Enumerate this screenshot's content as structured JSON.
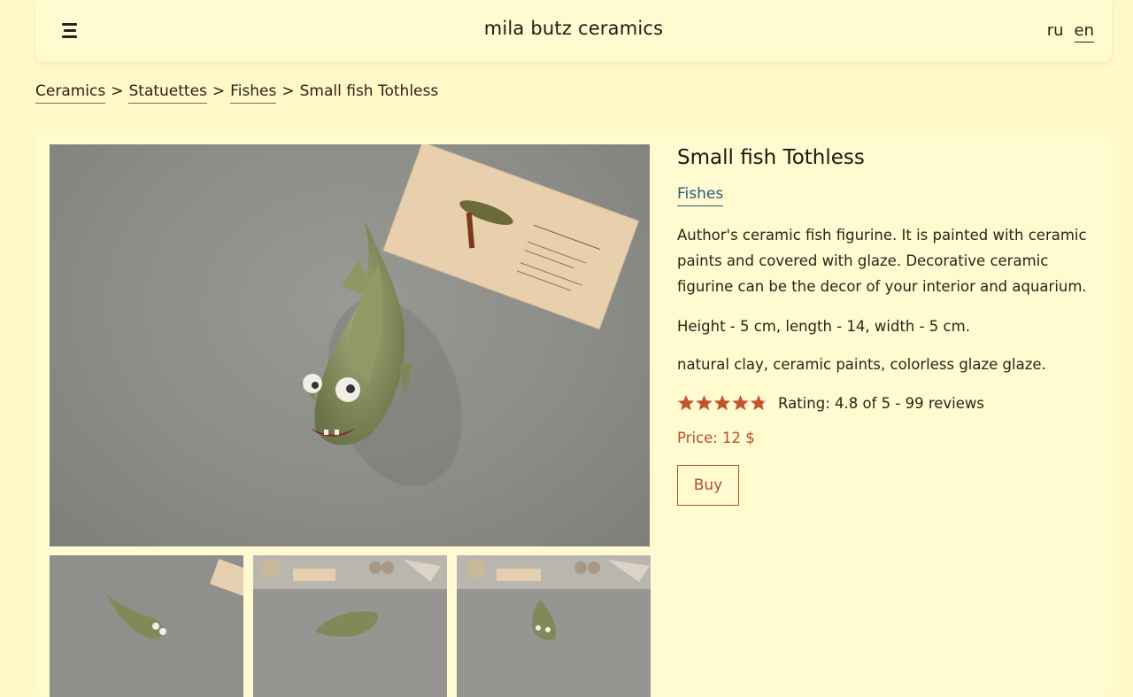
{
  "header": {
    "site_title": "mila butz ceramics",
    "menu_icon": "hamburger-icon",
    "languages": [
      {
        "label": "ru",
        "active": false
      },
      {
        "label": "en",
        "active": true
      }
    ]
  },
  "breadcrumb": {
    "items": [
      "Ceramics",
      "Statuettes",
      "Fishes"
    ],
    "current": "Small fish Tothless",
    "separator": ">"
  },
  "product": {
    "title": "Small fish Tothless",
    "category": "Fishes",
    "description": "Author's ceramic fish figurine. It is painted with ceramic paints and covered with glaze. Decorative ceramic figurine can be the decor of your interior and aquarium.",
    "dimensions": "Height - 5 cm, length - 14, width - 5 cm.",
    "materials": "natural clay, ceramic paints, colorless glaze glaze.",
    "rating_value": 4.8,
    "rating_max": 5,
    "rating_text": "Rating: 4.8 of 5 - 99 reviews",
    "price": "Price: 12 $",
    "buy_label": "Buy"
  },
  "colors": {
    "background": "#fff8c8",
    "card": "#fffad0",
    "accent": "#b0532a",
    "link": "#2a5b7e"
  }
}
